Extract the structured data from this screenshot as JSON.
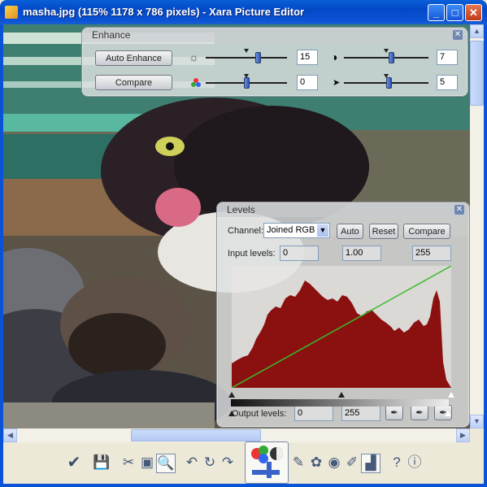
{
  "window": {
    "title": "masha.jpg (115% 1178 x 786 pixels) - Xara Picture Editor",
    "minimize_glyph": "_",
    "maximize_glyph": "□",
    "close_glyph": "✕"
  },
  "enhance": {
    "title": "Enhance",
    "auto_enhance_label": "Auto Enhance",
    "compare_label": "Compare",
    "sliders": [
      {
        "id": "brightness",
        "icon": "sun-icon",
        "value": "15",
        "level": 0.64
      },
      {
        "id": "contrast",
        "icon": "contrast-icon",
        "value": "7",
        "level": 0.56
      },
      {
        "id": "saturation",
        "icon": "color-wheel-icon",
        "value": "0",
        "level": 0.5
      },
      {
        "id": "sharpness",
        "icon": "sharpen-icon",
        "value": "5",
        "level": 0.53
      }
    ]
  },
  "levels": {
    "title": "Levels",
    "channel_label": "Channel:",
    "channel_value": "Joined RGB",
    "auto_label": "Auto",
    "reset_label": "Reset",
    "compare_label": "Compare",
    "input_levels_label": "Input levels:",
    "input_black": "0",
    "input_gamma": "1.00",
    "input_white": "255",
    "output_levels_label": "Output levels:",
    "output_black": "0",
    "output_white": "255",
    "histogram_color": "#8b1010",
    "curve_color": "#3aba2a"
  },
  "toolbar": {
    "tools": [
      "ok-check-icon",
      "save-icon",
      "crop-icon",
      "fit-view-icon",
      "zoom-icon",
      "undo-icon",
      "rotate-icon",
      "redo-icon",
      "enhance-icon",
      "red-eye-icon",
      "effects-icon",
      "eye-icon",
      "brush-icon",
      "levels-icon",
      "help-icon",
      "info-icon"
    ]
  }
}
